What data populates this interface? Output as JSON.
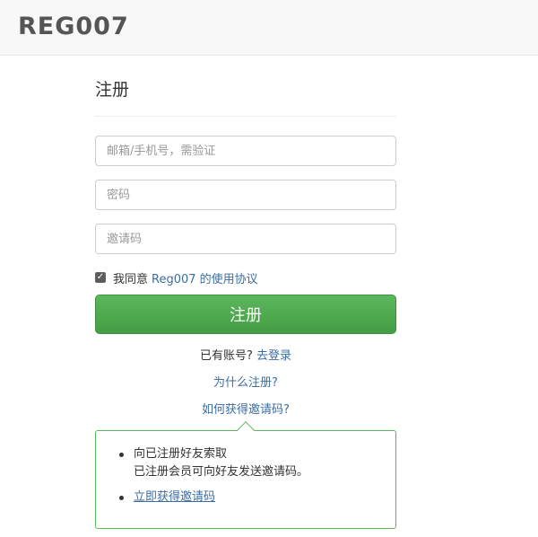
{
  "header": {
    "brand": "REG007"
  },
  "form": {
    "title": "注册",
    "account_placeholder": "邮箱/手机号，需验证",
    "password_placeholder": "密码",
    "invite_placeholder": "邀请码",
    "agree_text": "我同意",
    "agree_link": "Reg007 的使用协议",
    "agree_checked": true,
    "submit_label": "注册"
  },
  "links": {
    "have_account": "已有账号?",
    "login": "去登录",
    "why_register": "为什么注册?",
    "how_invite": "如何获得邀请码?"
  },
  "tips": {
    "item1_line1": "向已注册好友索取",
    "item1_line2": "已注册会员可向好友发送邀请码。",
    "item2_link": "立即获得邀请码"
  },
  "colors": {
    "accent_green": "#5cb85c",
    "link_blue": "#3a6ea5"
  }
}
